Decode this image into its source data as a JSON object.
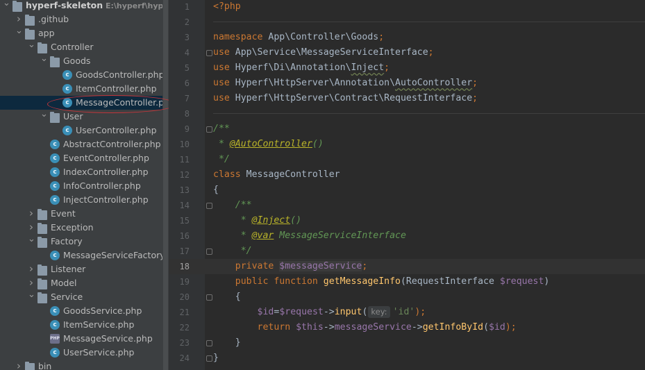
{
  "project_tree": {
    "rows": [
      {
        "label": "hyperf-skeleton",
        "path": "E:\\hyperf\\hyperf-s",
        "depth": 0,
        "type": "folder",
        "expanded": true,
        "root": true
      },
      {
        "label": ".github",
        "depth": 1,
        "type": "folder",
        "expanded": false
      },
      {
        "label": "app",
        "depth": 1,
        "type": "folder",
        "expanded": true
      },
      {
        "label": "Controller",
        "depth": 2,
        "type": "folder",
        "expanded": true
      },
      {
        "label": "Goods",
        "depth": 3,
        "type": "folder",
        "expanded": true
      },
      {
        "label": "GoodsController.php",
        "depth": 4,
        "type": "class"
      },
      {
        "label": "ItemController.php",
        "depth": 4,
        "type": "class"
      },
      {
        "label": "MessageController.php",
        "depth": 4,
        "type": "class",
        "selected": true
      },
      {
        "label": "User",
        "depth": 3,
        "type": "folder",
        "expanded": true
      },
      {
        "label": "UserController.php",
        "depth": 4,
        "type": "class"
      },
      {
        "label": "AbstractController.php",
        "depth": 3,
        "type": "class"
      },
      {
        "label": "EventController.php",
        "depth": 3,
        "type": "class"
      },
      {
        "label": "IndexController.php",
        "depth": 3,
        "type": "class"
      },
      {
        "label": "InfoController.php",
        "depth": 3,
        "type": "class"
      },
      {
        "label": "InjectController.php",
        "depth": 3,
        "type": "class"
      },
      {
        "label": "Event",
        "depth": 2,
        "type": "folder",
        "expanded": false
      },
      {
        "label": "Exception",
        "depth": 2,
        "type": "folder",
        "expanded": false
      },
      {
        "label": "Factory",
        "depth": 2,
        "type": "folder",
        "expanded": true
      },
      {
        "label": "MessageServiceFactory.php",
        "depth": 3,
        "type": "class"
      },
      {
        "label": "Listener",
        "depth": 2,
        "type": "folder",
        "expanded": false
      },
      {
        "label": "Model",
        "depth": 2,
        "type": "folder",
        "expanded": false
      },
      {
        "label": "Service",
        "depth": 2,
        "type": "folder",
        "expanded": true
      },
      {
        "label": "GoodsService.php",
        "depth": 3,
        "type": "class"
      },
      {
        "label": "ItemService.php",
        "depth": 3,
        "type": "class"
      },
      {
        "label": "MessageService.php",
        "depth": 3,
        "type": "php"
      },
      {
        "label": "UserService.php",
        "depth": 3,
        "type": "class"
      },
      {
        "label": "bin",
        "depth": 1,
        "type": "folder",
        "expanded": false
      }
    ]
  },
  "editor": {
    "current_line": 18,
    "param_hint": "key:",
    "lines": [
      [
        {
          "t": "<?php",
          "c": "phptag"
        }
      ],
      [],
      [
        {
          "t": "namespace ",
          "c": "kw"
        },
        {
          "t": "App\\Controller\\Goods",
          "c": "ns"
        },
        {
          "t": ";",
          "c": "kw"
        }
      ],
      [
        {
          "t": "use ",
          "c": "kw"
        },
        {
          "t": "App\\Service\\MessageServiceInterface",
          "c": "ns"
        },
        {
          "t": ";",
          "c": "kw"
        }
      ],
      [
        {
          "t": "use ",
          "c": "kw"
        },
        {
          "t": "Hyperf\\Di\\Annotation\\",
          "c": "ns"
        },
        {
          "t": "Inject",
          "c": "wavy"
        },
        {
          "t": ";",
          "c": "kw"
        }
      ],
      [
        {
          "t": "use ",
          "c": "kw"
        },
        {
          "t": "Hyperf\\HttpServer\\Annotation\\",
          "c": "ns"
        },
        {
          "t": "AutoController",
          "c": "wavy"
        },
        {
          "t": ";",
          "c": "kw"
        }
      ],
      [
        {
          "t": "use ",
          "c": "kw"
        },
        {
          "t": "Hyperf\\HttpServer\\Contract\\RequestInterface",
          "c": "ns"
        },
        {
          "t": ";",
          "c": "kw"
        }
      ],
      [],
      [
        {
          "t": "/**",
          "c": "cm"
        }
      ],
      [
        {
          "t": " * ",
          "c": "cm"
        },
        {
          "t": "@AutoController",
          "c": "ann"
        },
        {
          "t": "()",
          "c": "cm"
        }
      ],
      [
        {
          "t": " */",
          "c": "cm"
        }
      ],
      [
        {
          "t": "class ",
          "c": "kw"
        },
        {
          "t": "MessageController",
          "c": "ns"
        }
      ],
      [
        {
          "t": "{",
          "c": "ns"
        }
      ],
      [
        {
          "t": "    /**",
          "c": "cm"
        }
      ],
      [
        {
          "t": "     * ",
          "c": "cm"
        },
        {
          "t": "@Inject",
          "c": "ann"
        },
        {
          "t": "()",
          "c": "cm"
        }
      ],
      [
        {
          "t": "     * ",
          "c": "cm"
        },
        {
          "t": "@var",
          "c": "ann"
        },
        {
          "t": " MessageServiceInterface",
          "c": "cmi"
        }
      ],
      [
        {
          "t": "     */",
          "c": "cm"
        }
      ],
      [
        {
          "t": "    private ",
          "c": "kw"
        },
        {
          "t": "$messageService",
          "c": "var varhl"
        },
        {
          "t": ";",
          "c": "kw"
        }
      ],
      [
        {
          "t": "    public function ",
          "c": "kw"
        },
        {
          "t": "getMessageInfo",
          "c": "fn"
        },
        {
          "t": "(RequestInterface ",
          "c": "ns"
        },
        {
          "t": "$request",
          "c": "var"
        },
        {
          "t": ")",
          "c": "ns"
        }
      ],
      [
        {
          "t": "    {",
          "c": "ns"
        }
      ],
      [
        {
          "t": "        ",
          "c": "ns"
        },
        {
          "t": "$id",
          "c": "var"
        },
        {
          "t": "=",
          "c": "ns"
        },
        {
          "t": "$request",
          "c": "var"
        },
        {
          "t": "->",
          "c": "ns"
        },
        {
          "t": "input",
          "c": "fn"
        },
        {
          "t": "(",
          "c": "ns"
        },
        {
          "t": "key:",
          "c": "hint"
        },
        {
          "t": "'id'",
          "c": "str"
        },
        {
          "t": ");",
          "c": "kw"
        }
      ],
      [
        {
          "t": "        return ",
          "c": "kw"
        },
        {
          "t": "$this",
          "c": "var"
        },
        {
          "t": "->",
          "c": "ns"
        },
        {
          "t": "messageService",
          "c": "var"
        },
        {
          "t": "->",
          "c": "ns"
        },
        {
          "t": "getInfoById",
          "c": "fn"
        },
        {
          "t": "(",
          "c": "ns"
        },
        {
          "t": "$id",
          "c": "var"
        },
        {
          "t": ");",
          "c": "kw"
        }
      ],
      [
        {
          "t": "    }",
          "c": "ns"
        }
      ],
      [
        {
          "t": "}",
          "c": "ns"
        }
      ]
    ]
  },
  "colors": {
    "selection": "#0d293e",
    "annotation_circle": "#c5363b",
    "php_keyword": "#cc7832"
  }
}
